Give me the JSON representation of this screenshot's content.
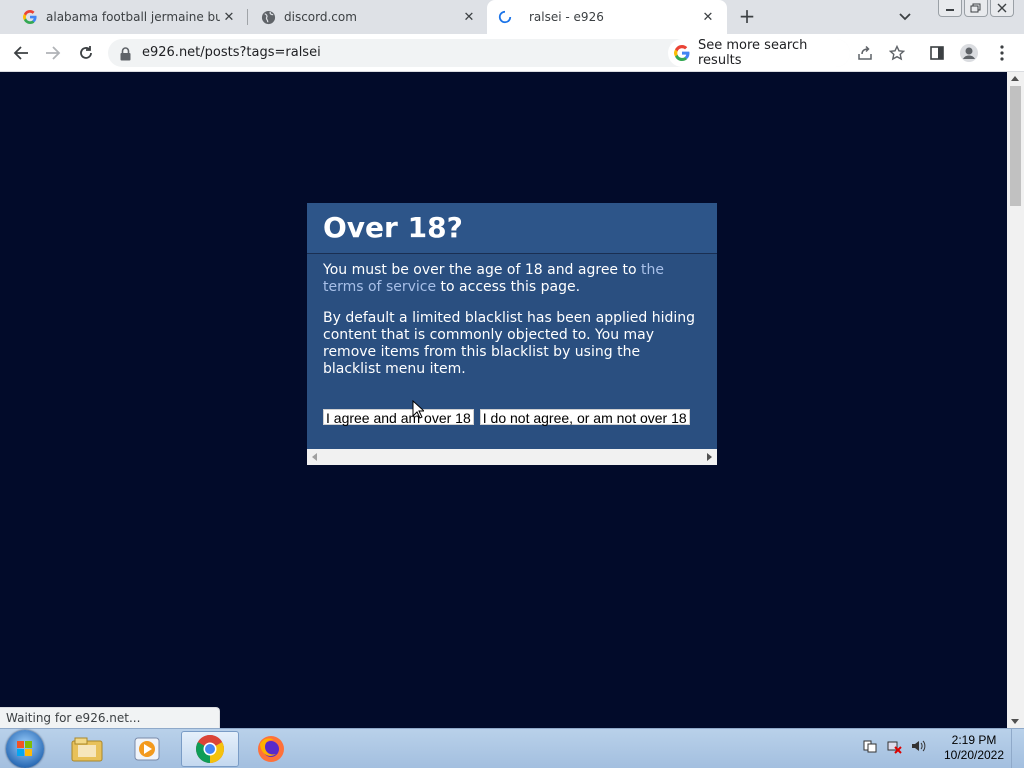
{
  "browser": {
    "tabs": [
      {
        "title": "alabama football jermaine burto",
        "favicon": "google-icon",
        "active": false
      },
      {
        "title": "discord.com",
        "favicon": "globe-icon",
        "active": false
      },
      {
        "title": "ralsei - e926",
        "favicon": "loading-spinner-icon",
        "active": true
      }
    ],
    "new_tab_label": "+",
    "url": "e926.net/posts?tags=ralsei",
    "search_chip": "See more search results",
    "status_text": "Waiting for e926.net..."
  },
  "dialog": {
    "title": "Over 18?",
    "para1_before": "You must be over the age of 18 and agree to ",
    "para1_link": "the terms of service",
    "para1_after": " to access this page.",
    "para2": "By default a limited blacklist has been applied hiding content that is commonly objected to. You may remove items from this blacklist by using the blacklist menu item.",
    "agree_button": "I agree and am over 18",
    "disagree_button": "I do not agree, or am not over 18"
  },
  "taskbar": {
    "clock_time": "2:19 PM",
    "clock_date": "10/20/2022",
    "apps": [
      "windows-explorer-icon",
      "media-player-icon",
      "chrome-icon",
      "firefox-icon"
    ]
  },
  "colors": {
    "page_background": "#020b2a",
    "dialog_background": "#2a4f80",
    "link": "#a8c0e8"
  }
}
